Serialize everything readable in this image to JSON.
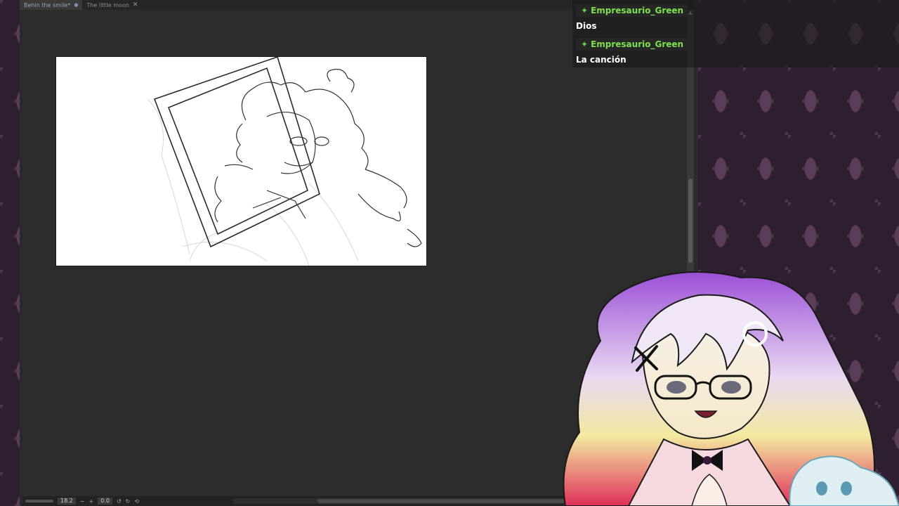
{
  "tabs": [
    {
      "label": "Behin the smile*",
      "active": true,
      "marker": "●"
    },
    {
      "label": "The little moon",
      "active": false,
      "close": "✕"
    }
  ],
  "statusbar": {
    "zoom": "18.2",
    "minus": "−",
    "plus": "+",
    "rotation": "0.0"
  },
  "chat": {
    "messages": [
      {
        "user": "Empresaurio_Green",
        "text": "Dios"
      },
      {
        "user": "Empresaurio_Green",
        "text": "La canción"
      }
    ],
    "badge_icon": "✦",
    "username_color": "#7ee04f"
  },
  "colors": {
    "workspace": "#2c2c2c",
    "canvas": "#ffffff",
    "damask": "#2e2030"
  }
}
